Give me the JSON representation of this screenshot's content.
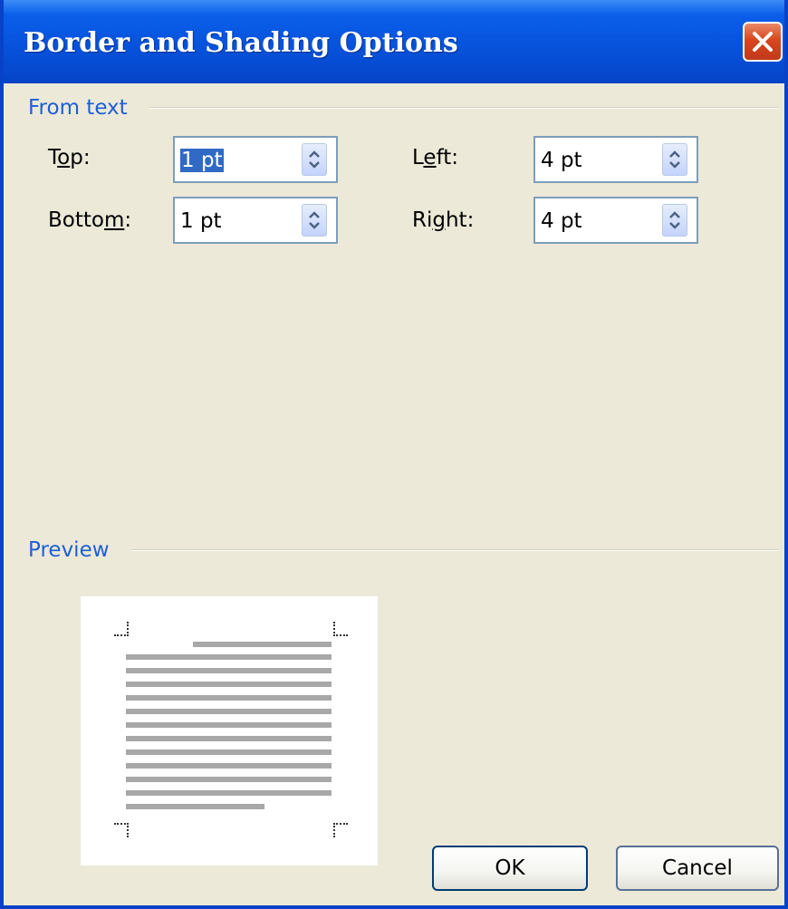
{
  "window": {
    "title": "Border and Shading Options",
    "close_icon": "close-icon"
  },
  "from_text": {
    "group_label": "From text",
    "top": {
      "label_pre": "T",
      "label_ul": "o",
      "label_post": "p:",
      "value": "1 pt"
    },
    "bottom": {
      "label_pre": "Botto",
      "label_ul": "m",
      "label_post": ":",
      "value": "1 pt"
    },
    "left": {
      "label_pre": "L",
      "label_ul": "e",
      "label_post": "ft:",
      "value": "4 pt"
    },
    "right": {
      "label_pre": "Ri",
      "label_ul": "g",
      "label_post": "ht:",
      "value": "4 pt"
    }
  },
  "preview": {
    "group_label": "Preview"
  },
  "buttons": {
    "ok": "OK",
    "cancel": "Cancel"
  },
  "colors": {
    "title_bar": "#0753dc",
    "group_label": "#1d5fd6",
    "selection": "#316ac5",
    "dialog_bg": "#ece9d8"
  }
}
